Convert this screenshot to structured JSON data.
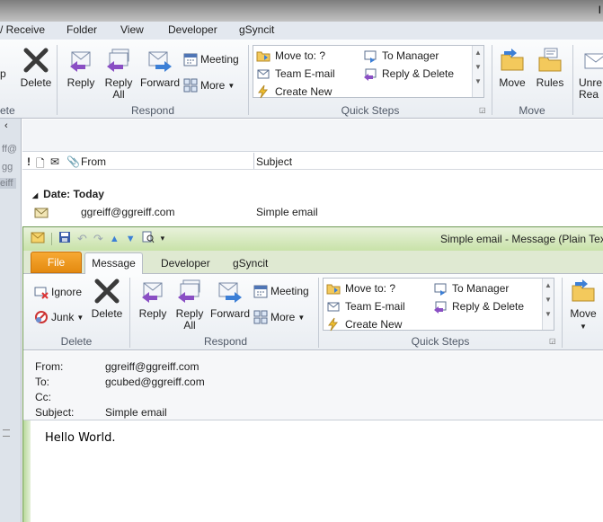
{
  "background_window": {
    "title_partial": "I",
    "tabs": [
      "/ Receive",
      "Folder",
      "View",
      "Developer",
      "gSyncit"
    ],
    "ribbon": {
      "partial_left_button": "p",
      "delete_group": {
        "delete": "Delete",
        "label_partial": "ete"
      },
      "respond": {
        "reply": "Reply",
        "reply_all_1": "Reply",
        "reply_all_2": "All",
        "forward": "Forward",
        "meeting": "Meeting",
        "more": "More",
        "label": "Respond"
      },
      "quick_steps": {
        "move_to": "Move to: ?",
        "to_manager": "To Manager",
        "team_email": "Team E-mail",
        "reply_delete": "Reply & Delete",
        "create_new": "Create New",
        "label": "Quick Steps"
      },
      "move": {
        "move": "Move",
        "rules": "Rules",
        "label": "Move"
      },
      "unread_partial_1": "Unre",
      "unread_partial_2": "Rea"
    },
    "left_nav_partial": [
      "ff@",
      "gg",
      "eiff"
    ],
    "columns": {
      "from": "From",
      "subject": "Subject"
    },
    "group_header": "Date: Today",
    "row": {
      "from": "ggreiff@ggreiff.com",
      "subject": "Simple email"
    }
  },
  "message_window": {
    "title": "Simple email  -  Message (Plain Tex",
    "file_tab": "File",
    "tabs": [
      "Message",
      "Developer",
      "gSyncit"
    ],
    "ribbon": {
      "delete_group": {
        "ignore": "Ignore",
        "junk": "Junk",
        "delete": "Delete",
        "label": "Delete"
      },
      "respond": {
        "reply": "Reply",
        "reply_all_1": "Reply",
        "reply_all_2": "All",
        "forward": "Forward",
        "meeting": "Meeting",
        "more": "More",
        "label": "Respond"
      },
      "quick_steps": {
        "move_to": "Move to: ?",
        "to_manager": "To Manager",
        "team_email": "Team E-mail",
        "reply_delete": "Reply & Delete",
        "create_new": "Create New",
        "label": "Quick Steps"
      },
      "move": {
        "move": "Move"
      }
    },
    "header": {
      "from_label": "From:",
      "from": "ggreiff@ggreiff.com",
      "to_label": "To:",
      "to": "gcubed@ggreiff.com",
      "cc_label": "Cc:",
      "subject_label": "Subject:",
      "subject": "Simple email"
    },
    "body": "Hello World."
  }
}
